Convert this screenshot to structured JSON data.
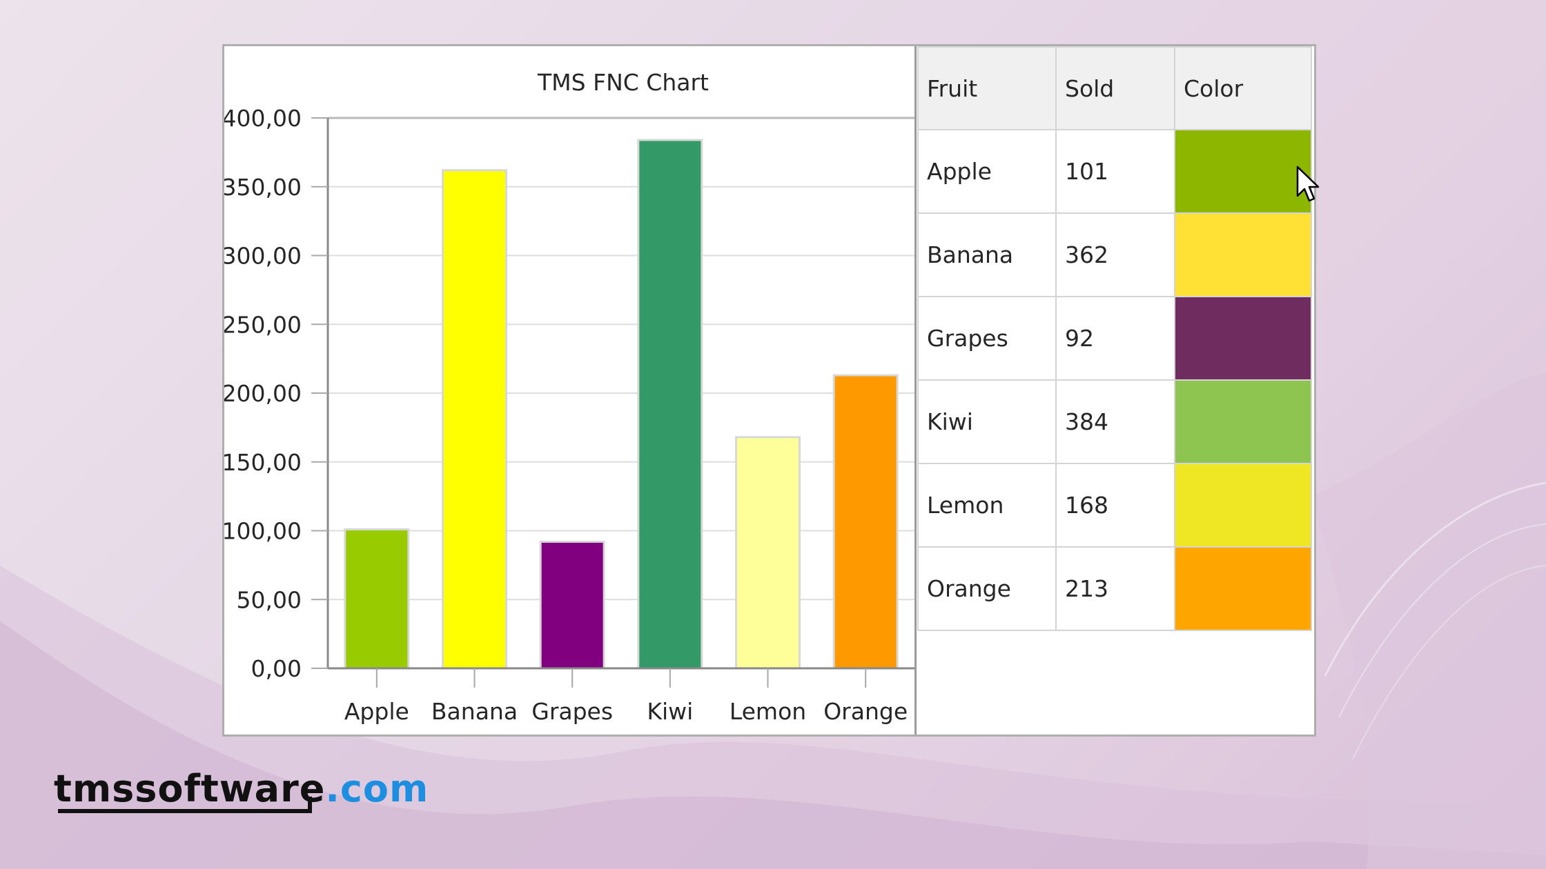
{
  "chart_data": {
    "type": "bar",
    "title": "TMS FNC Chart",
    "categories": [
      "Apple",
      "Banana",
      "Grapes",
      "Kiwi",
      "Lemon",
      "Orange"
    ],
    "values": [
      101,
      362,
      92,
      384,
      168,
      213
    ],
    "bar_colors": [
      "#99cc00",
      "#ffff00",
      "#800080",
      "#339966",
      "#ffff99",
      "#ff9900"
    ],
    "ylim": [
      0,
      400
    ],
    "yticks": [
      "0,00",
      "50,00",
      "100,00",
      "150,00",
      "200,00",
      "250,00",
      "300,00",
      "350,00",
      "400,00"
    ],
    "ytick_step": 50,
    "xlabel": "",
    "ylabel": "",
    "grid": true,
    "legend": "none"
  },
  "grid": {
    "headers": {
      "fruit": "Fruit",
      "sold": "Sold",
      "color": "Color"
    },
    "rows": [
      {
        "fruit": "Apple",
        "sold": "101",
        "color": "#8db600"
      },
      {
        "fruit": "Banana",
        "sold": "362",
        "color": "#ffe135"
      },
      {
        "fruit": "Grapes",
        "sold": "92",
        "color": "#6f2d5f"
      },
      {
        "fruit": "Kiwi",
        "sold": "384",
        "color": "#8ec450"
      },
      {
        "fruit": "Lemon",
        "sold": "168",
        "color": "#efe624"
      },
      {
        "fruit": "Orange",
        "sold": "213",
        "color": "#ffa500"
      }
    ]
  },
  "logo": {
    "main": "tmssoftware",
    "dot": ".com"
  },
  "icons": {
    "cursor": "mouse-pointer-icon"
  }
}
